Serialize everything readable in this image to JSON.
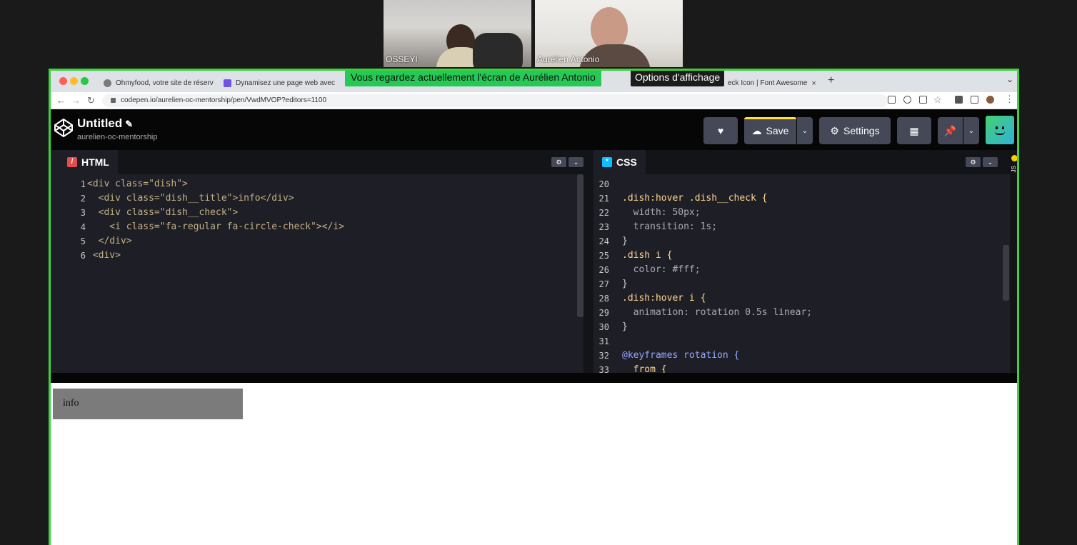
{
  "participants": [
    {
      "name": "OSSEYI"
    },
    {
      "name": "Aurélien Antonio"
    }
  ],
  "share_banner": {
    "text": "Vous regardez actuellement l'écran de Aurélien Antonio",
    "options": "Options d'affichage"
  },
  "browser": {
    "tabs": [
      {
        "title": "Ohmyfood, votre site de réserv",
        "close": "×",
        "icon_color": "#7a7a7a"
      },
      {
        "title": "Dynamisez une page web avec",
        "close": "×",
        "icon_color": "#7451eb"
      },
      {
        "title": "eck Icon | Font Awesome",
        "close": "×",
        "icon_color": "#528dd7"
      }
    ],
    "new_tab": "+",
    "menu": "⌄",
    "url": "codepen.io/aurelien-oc-mentorship/pen/VwdMVOP?editors=1100"
  },
  "codepen": {
    "title": "Untitled",
    "user": "aurelien-oc-mentorship",
    "buttons": {
      "save": "Save",
      "settings": "Settings"
    },
    "html_tab": "HTML",
    "css_tab": "CSS",
    "js_side_label": "JS",
    "html_code": [
      {
        "n": "1",
        "text": "<div class=\"dish\">"
      },
      {
        "n": "2",
        "text": "  <div class=\"dish__title\">info</div>"
      },
      {
        "n": "3",
        "text": "  <div class=\"dish__check\">"
      },
      {
        "n": "4",
        "text": "    <i class=\"fa-regular fa-circle-check\"></i>"
      },
      {
        "n": "5",
        "text": "  </div>"
      },
      {
        "n": "6",
        "text": " <div>"
      }
    ],
    "css_code": [
      {
        "n": "20",
        "text": ""
      },
      {
        "n": "21",
        "text": ".dish:hover .dish__check {"
      },
      {
        "n": "22",
        "text": "  width: 50px;"
      },
      {
        "n": "23",
        "text": "  transition: 1s;"
      },
      {
        "n": "24",
        "text": "}"
      },
      {
        "n": "25",
        "text": ".dish i {"
      },
      {
        "n": "26",
        "text": "  color: #fff;"
      },
      {
        "n": "27",
        "text": "}"
      },
      {
        "n": "28",
        "text": ".dish:hover i {"
      },
      {
        "n": "29",
        "text": "  animation: rotation 0.5s linear;"
      },
      {
        "n": "30",
        "text": "}"
      },
      {
        "n": "31",
        "text": ""
      },
      {
        "n": "32",
        "text": "@keyframes rotation {"
      },
      {
        "n": "33",
        "text": "  from {"
      }
    ]
  },
  "result": {
    "info_text": "info"
  },
  "colors": {
    "share_border": "#3ed23e",
    "banner": "#25c955",
    "codepen_bg": "#060606",
    "editor_bg": "#1e1f26"
  }
}
